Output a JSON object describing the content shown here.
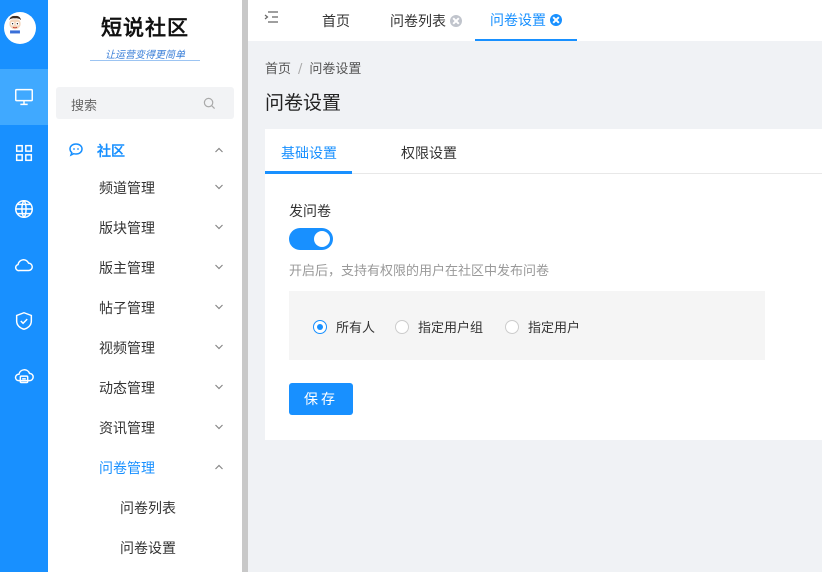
{
  "brand": {
    "title": "短说社区",
    "slogan": "让运营变得更简单"
  },
  "rail": {
    "items": [
      {
        "icon": "monitor-icon",
        "active": true
      },
      {
        "icon": "apps-grid-icon",
        "active": false
      },
      {
        "icon": "globe-icon",
        "active": false
      },
      {
        "icon": "cloud-icon",
        "active": false
      },
      {
        "icon": "shield-check-icon",
        "active": false
      },
      {
        "icon": "cloud-server-icon",
        "active": false
      }
    ]
  },
  "sidebar": {
    "search_placeholder": "搜索",
    "section": {
      "label": "社区",
      "icon": "chat-icon",
      "expanded": true
    },
    "items": [
      {
        "label": "频道管理",
        "expanded": false
      },
      {
        "label": "版块管理",
        "expanded": false
      },
      {
        "label": "版主管理",
        "expanded": false
      },
      {
        "label": "帖子管理",
        "expanded": false
      },
      {
        "label": "视频管理",
        "expanded": false
      },
      {
        "label": "动态管理",
        "expanded": false
      },
      {
        "label": "资讯管理",
        "expanded": false
      },
      {
        "label": "问卷管理",
        "expanded": true
      }
    ],
    "children": [
      {
        "label": "问卷列表"
      },
      {
        "label": "问卷设置"
      }
    ]
  },
  "tabs": [
    {
      "label": "首页",
      "closable": false,
      "active": false
    },
    {
      "label": "问卷列表",
      "closable": true,
      "active": false
    },
    {
      "label": "问卷设置",
      "closable": true,
      "active": true
    }
  ],
  "breadcrumb": {
    "home": "首页",
    "separator": "/",
    "current": "问卷设置"
  },
  "page": {
    "title": "问卷设置"
  },
  "settings_tabs": [
    {
      "label": "基础设置",
      "active": true
    },
    {
      "label": "权限设置",
      "active": false
    }
  ],
  "form": {
    "toggle_label": "发问卷",
    "toggle_on": true,
    "hint": "开启后，支持有权限的用户在社区中发布问卷",
    "radios": [
      {
        "label": "所有人",
        "checked": true
      },
      {
        "label": "指定用户组",
        "checked": false
      },
      {
        "label": "指定用户",
        "checked": false
      }
    ],
    "save_label": "保存"
  },
  "colors": {
    "accent": "#1890ff",
    "rail_active": "#40a9ff",
    "page_bg": "#f0f2f5"
  }
}
